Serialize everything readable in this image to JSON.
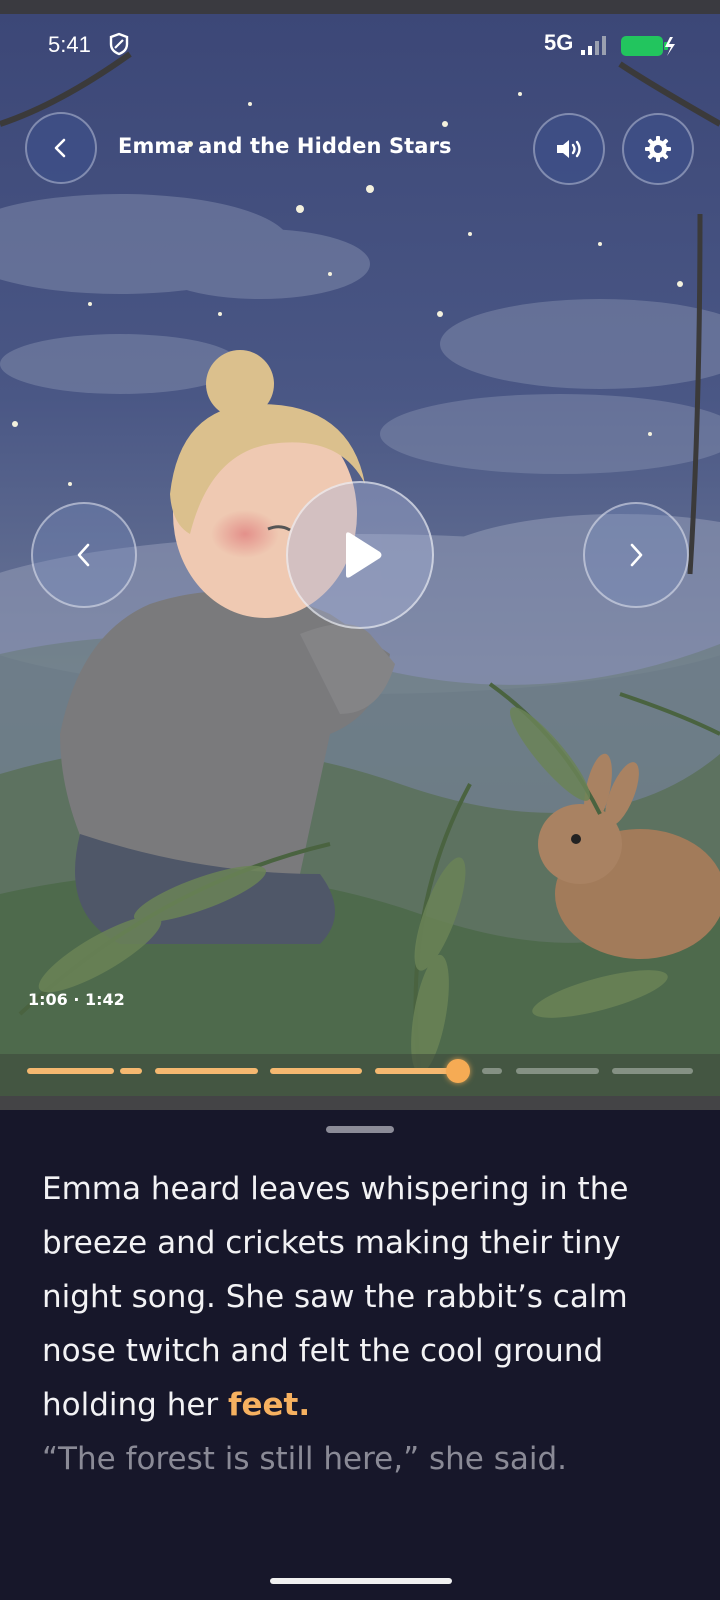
{
  "status_bar": {
    "time": "5:41",
    "network": "5G",
    "icons": [
      "shield-icon",
      "signal-icon",
      "battery-charging-icon"
    ],
    "battery_color": "#22c55e"
  },
  "header": {
    "title": "Emma and the Hidden Stars",
    "back_icon": "chevron-left-icon",
    "sound_icon": "speaker-icon",
    "settings_icon": "gear-icon"
  },
  "player": {
    "elapsed_total": "1:06 · 1:42",
    "progress_fraction": 0.65,
    "prev_icon": "chevron-left-icon",
    "next_icon": "chevron-right-icon",
    "play_icon": "play-icon",
    "accent_color": "#f6ab54"
  },
  "story": {
    "read_text": "Emma heard leaves whispering in the breeze and crickets making their tiny night song. She saw the rabbit’s calm nose twitch and felt the cool ground holding her ",
    "current_word": "feet.",
    "upcoming_text": "“The forest is still here,” she said."
  }
}
